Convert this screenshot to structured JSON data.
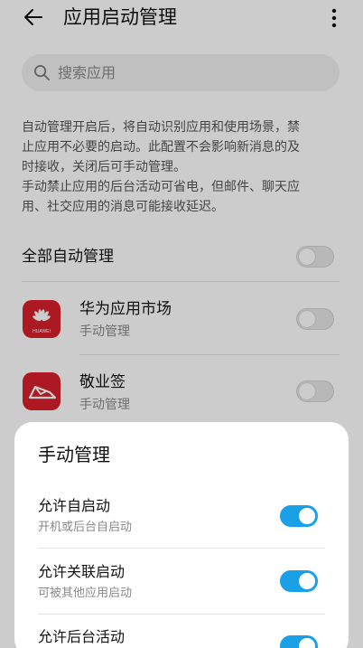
{
  "header": {
    "title": "应用启动管理",
    "back_icon": "arrow-left-icon",
    "more_icon": "more-vertical-icon"
  },
  "search": {
    "placeholder": "搜索应用",
    "icon": "search-icon"
  },
  "description": {
    "lines": [
      "自动管理开启后，将自动识别应用和使用场景，禁",
      "止应用不必要的启动。此配置不会影响新消息的及",
      "时接收，关闭后可手动管理。",
      "手动禁止应用的后台活动可省电，但邮件、聊天应",
      "用、社交应用的消息可能接收延迟。"
    ]
  },
  "all_auto": {
    "label": "全部自动管理",
    "enabled": false
  },
  "apps": [
    {
      "name": "华为应用市场",
      "status": "手动管理",
      "icon": "huawei-appgallery-icon",
      "icon_text": "HUAWEI",
      "enabled": false,
      "color": "#d8202b"
    },
    {
      "name": "敬业签",
      "status": "手动管理",
      "icon": "jingyeqian-icon",
      "enabled": false,
      "color": "#d8202b"
    }
  ],
  "sheet": {
    "title": "手动管理",
    "options": [
      {
        "title": "允许自启动",
        "subtitle": "开机或后台自启动",
        "enabled": true
      },
      {
        "title": "允许关联启动",
        "subtitle": "可被其他应用启动",
        "enabled": true
      },
      {
        "title": "允许后台活动",
        "subtitle": "",
        "enabled": true
      }
    ]
  },
  "colors": {
    "accent": "#1aa0e6",
    "app_red": "#d8202b",
    "overlay": "rgba(0,0,0,0.2)"
  }
}
